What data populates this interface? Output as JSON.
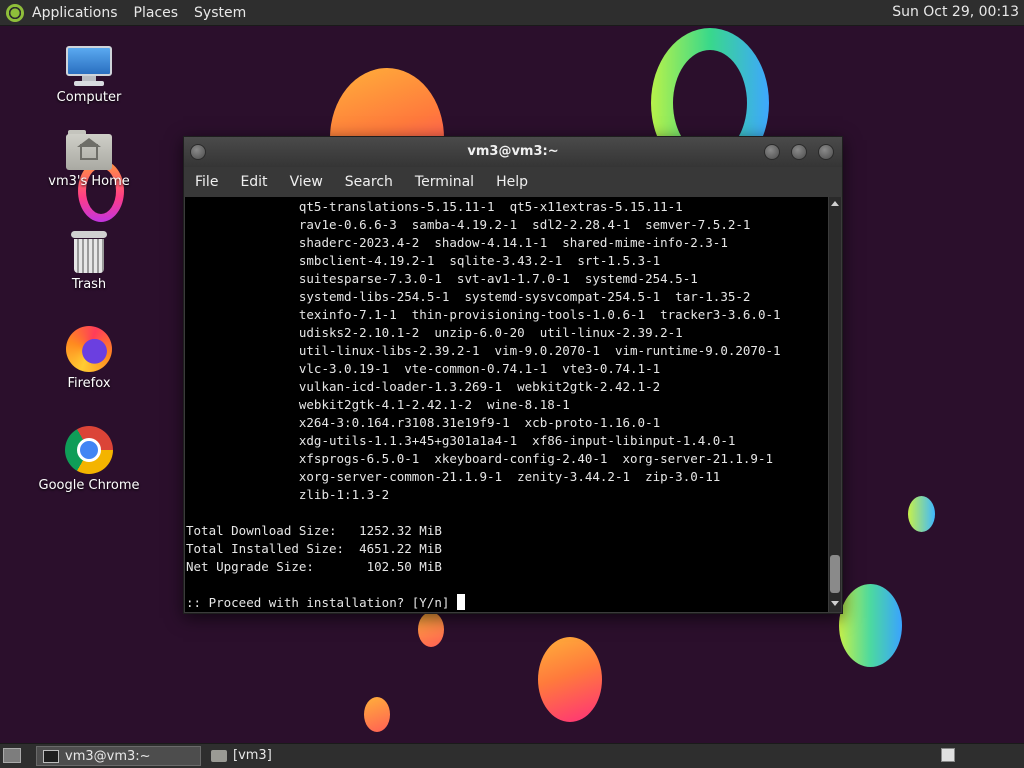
{
  "top_panel": {
    "menus": [
      "Applications",
      "Places",
      "System"
    ],
    "clock": "Sun Oct 29, 00:13"
  },
  "desktop_icons": [
    {
      "label": "Computer",
      "icon": "computer-icon"
    },
    {
      "label": "vm3's Home",
      "icon": "home-folder-icon"
    },
    {
      "label": "Trash",
      "icon": "trash-icon"
    },
    {
      "label": "Firefox",
      "icon": "firefox-icon"
    },
    {
      "label": "Google Chrome",
      "icon": "chrome-icon"
    }
  ],
  "terminal": {
    "title": "vm3@vm3:~",
    "menu": [
      "File",
      "Edit",
      "View",
      "Search",
      "Terminal",
      "Help"
    ],
    "lines": [
      "               qt5-translations-5.15.11-1  qt5-x11extras-5.15.11-1",
      "               rav1e-0.6.6-3  samba-4.19.2-1  sdl2-2.28.4-1  semver-7.5.2-1",
      "               shaderc-2023.4-2  shadow-4.14.1-1  shared-mime-info-2.3-1",
      "               smbclient-4.19.2-1  sqlite-3.43.2-1  srt-1.5.3-1",
      "               suitesparse-7.3.0-1  svt-av1-1.7.0-1  systemd-254.5-1",
      "               systemd-libs-254.5-1  systemd-sysvcompat-254.5-1  tar-1.35-2",
      "               texinfo-7.1-1  thin-provisioning-tools-1.0.6-1  tracker3-3.6.0-1",
      "               udisks2-2.10.1-2  unzip-6.0-20  util-linux-2.39.2-1",
      "               util-linux-libs-2.39.2-1  vim-9.0.2070-1  vim-runtime-9.0.2070-1",
      "               vlc-3.0.19-1  vte-common-0.74.1-1  vte3-0.74.1-1",
      "               vulkan-icd-loader-1.3.269-1  webkit2gtk-2.42.1-2",
      "               webkit2gtk-4.1-2.42.1-2  wine-8.18-1",
      "               x264-3:0.164.r3108.31e19f9-1  xcb-proto-1.16.0-1",
      "               xdg-utils-1.1.3+45+g301a1a4-1  xf86-input-libinput-1.4.0-1",
      "               xfsprogs-6.5.0-1  xkeyboard-config-2.40-1  xorg-server-21.1.9-1",
      "               xorg-server-common-21.1.9-1  zenity-3.44.2-1  zip-3.0-11",
      "               zlib-1:1.3-2",
      "",
      "Total Download Size:   1252.32 MiB",
      "Total Installed Size:  4651.22 MiB",
      "Net Upgrade Size:       102.50 MiB",
      ""
    ],
    "prompt": ":: Proceed with installation? [Y/n] "
  },
  "bottom_panel": {
    "tasks": [
      {
        "label": "vm3@vm3:~",
        "icon": "terminal-icon",
        "active": true
      },
      {
        "label": "[vm3]",
        "icon": "folder-icon",
        "active": false
      }
    ]
  }
}
